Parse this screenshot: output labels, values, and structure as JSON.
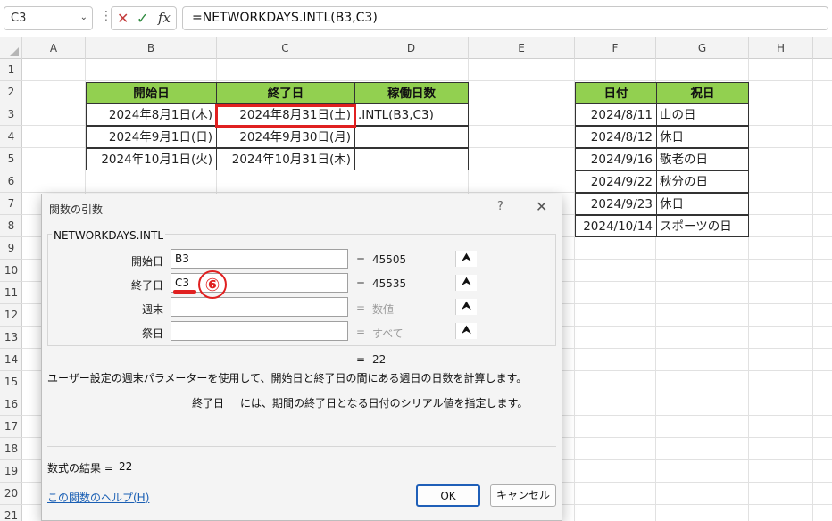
{
  "formula_bar": {
    "name_box": "C3",
    "cancel_icon": "x-icon",
    "enter_icon": "check-icon",
    "fx_label": "fx",
    "formula": "=NETWORKDAYS.INTL(B3,C3)"
  },
  "columns": [
    "A",
    "B",
    "C",
    "D",
    "E",
    "F",
    "G",
    "H"
  ],
  "rows": [
    "1",
    "2",
    "3",
    "4",
    "5",
    "6",
    "7",
    "8",
    "9",
    "10",
    "11",
    "12",
    "13",
    "14",
    "15",
    "16",
    "17",
    "18",
    "19",
    "20",
    "21"
  ],
  "table1": {
    "headers": [
      "開始日",
      "終了日",
      "稼働日数"
    ],
    "rows": [
      {
        "start": "2024年8月1日(木)",
        "end": "2024年8月31日(土)",
        "days": ".INTL(B3,C3)"
      },
      {
        "start": "2024年9月1日(日)",
        "end": "2024年9月30日(月)",
        "days": ""
      },
      {
        "start": "2024年10月1日(火)",
        "end": "2024年10月31日(木)",
        "days": ""
      }
    ]
  },
  "table2": {
    "headers": [
      "日付",
      "祝日"
    ],
    "rows": [
      {
        "date": "2024/8/11",
        "name": "山の日"
      },
      {
        "date": "2024/8/12",
        "name": "休日"
      },
      {
        "date": "2024/9/16",
        "name": "敬老の日"
      },
      {
        "date": "2024/9/22",
        "name": "秋分の日"
      },
      {
        "date": "2024/9/23",
        "name": "休日"
      },
      {
        "date": "2024/10/14",
        "name": "スポーツの日"
      }
    ]
  },
  "dialog": {
    "title": "関数の引数",
    "help_q": "?",
    "close": "✕",
    "function_name": "NETWORKDAYS.INTL",
    "args": [
      {
        "label": "開始日",
        "value": "B3",
        "result": "45505",
        "muted": false
      },
      {
        "label": "終了日",
        "value": "C3",
        "result": "45535",
        "muted": false
      },
      {
        "label": "週末",
        "value": "",
        "result": "数値",
        "muted": true
      },
      {
        "label": "祭日",
        "value": "",
        "result": "すべて",
        "muted": true
      }
    ],
    "equals": "=",
    "overall_result": "22",
    "description": "ユーザー設定の週末パラメーターを使用して、開始日と終了日の間にある週日の日数を計算します。",
    "arg_desc_name": "終了日",
    "arg_desc_text": "には、期間の終了日となる日付のシリアル値を指定します。",
    "result_label": "数式の結果 =",
    "result_value": "22",
    "help_link": "この関数のヘルプ(H)",
    "ok": "OK",
    "cancel": "キャンセル"
  },
  "annotation": {
    "step": "⑥",
    "color": "#e02020"
  },
  "colors": {
    "header_green": "#92d050",
    "accent_blue": "#1f5fb8"
  }
}
